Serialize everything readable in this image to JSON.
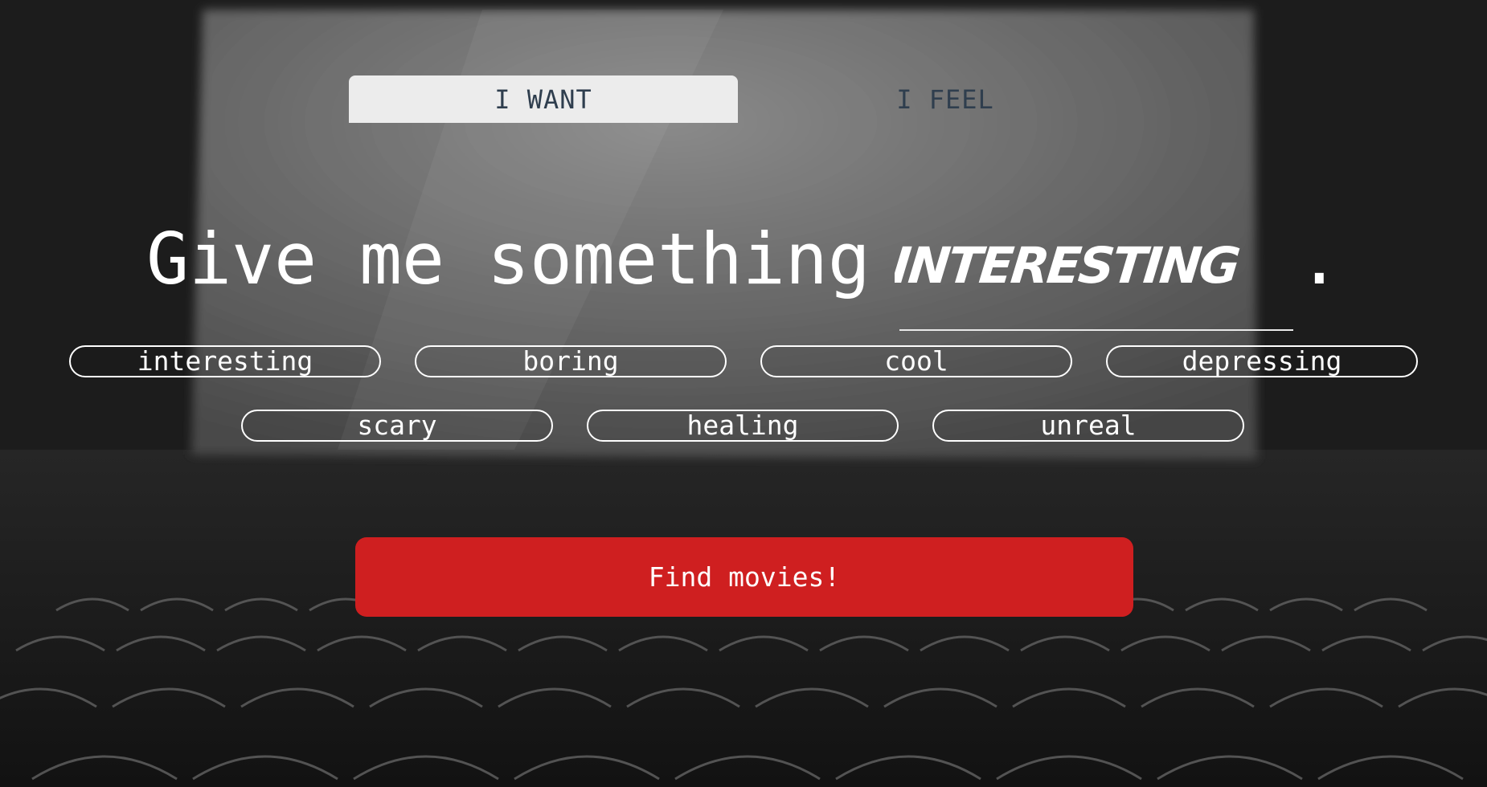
{
  "tabs": [
    {
      "label": "I WANT",
      "active": true
    },
    {
      "label": "I FEEL",
      "active": false
    }
  ],
  "headline": {
    "prefix": "Give me something",
    "selected_word": "INTERESTING",
    "suffix": "."
  },
  "options": [
    "interesting",
    "boring",
    "cool",
    "depressing",
    "scary",
    "healing",
    "unreal"
  ],
  "find_button": {
    "label": "Find movies!"
  },
  "colors": {
    "accent_red": "#cf1f20",
    "tab_active_bg": "#ececec",
    "tab_text": "#2f3e4e",
    "text": "#ffffff"
  },
  "background": {
    "scene": "cinema-auditorium-icon"
  }
}
